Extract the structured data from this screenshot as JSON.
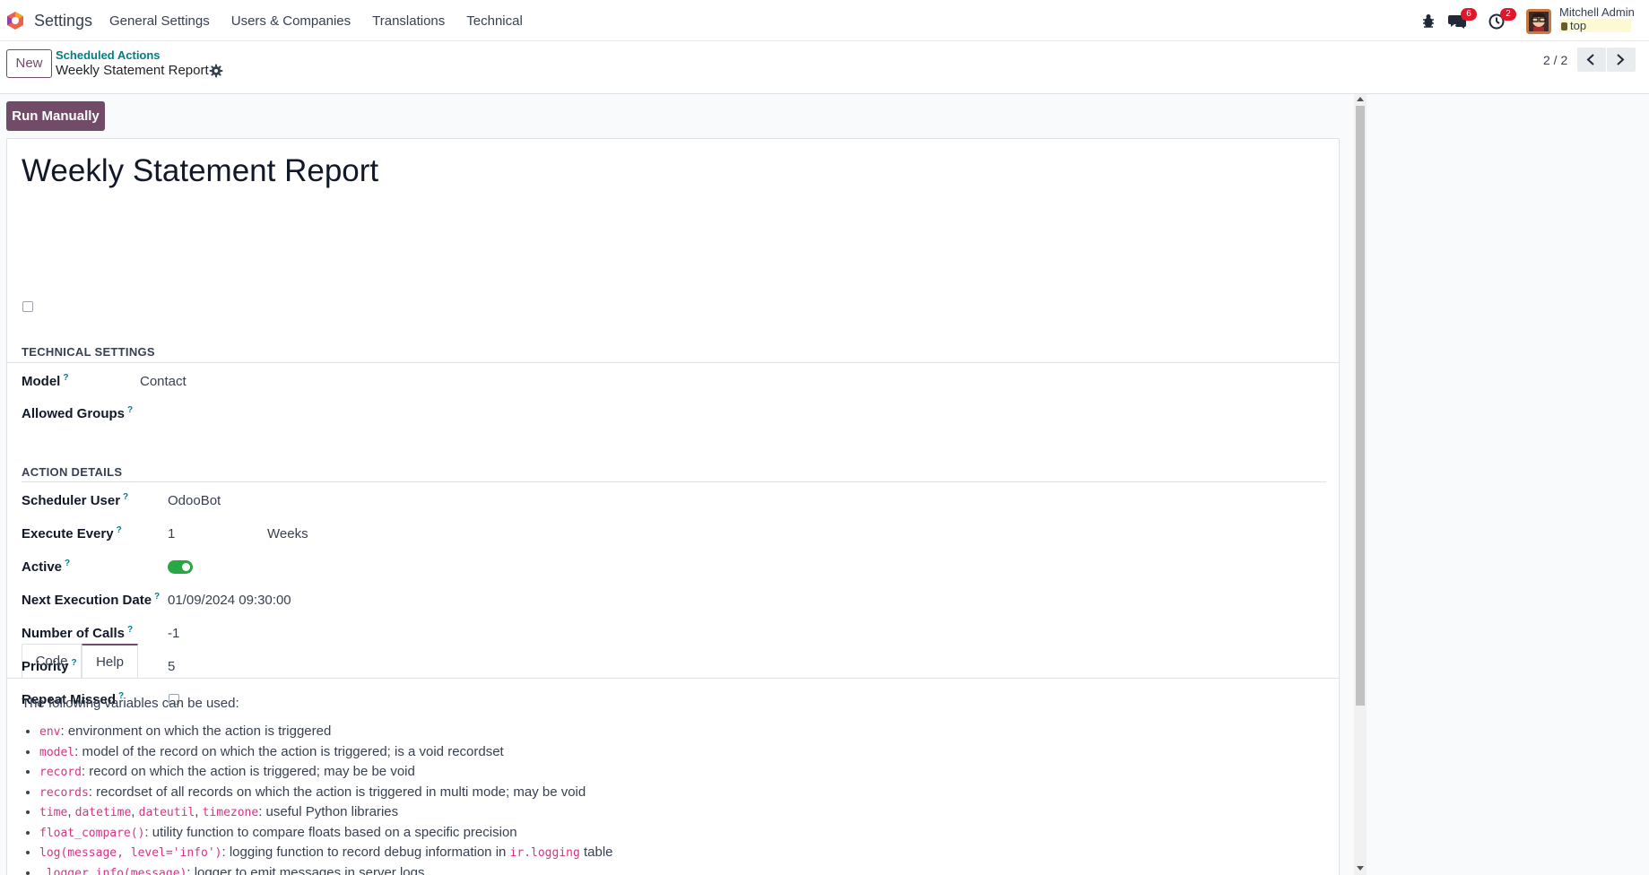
{
  "navbar": {
    "app_name": "Settings",
    "menu": [
      "General Settings",
      "Users & Companies",
      "Translations",
      "Technical"
    ],
    "messages_count": "6",
    "activities_count": "2",
    "user_name": "Mitchell Admin",
    "database": "top"
  },
  "control_panel": {
    "new_label": "New",
    "breadcrumb_parent": "Scheduled Actions",
    "breadcrumb_current": "Weekly Statement Report",
    "pager": "2 / 2"
  },
  "form": {
    "run_button": "Run Manually",
    "title": "Weekly Statement Report",
    "technical_section": "TECHNICAL SETTINGS",
    "model_label": "Model",
    "model_value": "Contact",
    "allowed_groups_label": "Allowed Groups",
    "action_section": "ACTION DETAILS",
    "scheduler_user_label": "Scheduler User",
    "scheduler_user_value": "OdooBot",
    "execute_every_label": "Execute Every",
    "execute_every_value": "1",
    "execute_every_unit": "Weeks",
    "active_label": "Active",
    "active": true,
    "next_execution_label": "Next Execution Date",
    "next_execution_value": "01/09/2024 09:30:00",
    "number_of_calls_label": "Number of Calls",
    "number_of_calls_value": "-1",
    "priority_label": "Priority",
    "priority_value": "5",
    "repeat_missed_label": "Repeat Missed",
    "help_marker": "?"
  },
  "tabs": {
    "code": "Code",
    "help": "Help"
  },
  "help": {
    "intro": "The following variables can be used:",
    "items": [
      {
        "codes": [
          "env"
        ],
        "text": ": environment on which the action is triggered"
      },
      {
        "codes": [
          "model"
        ],
        "text": ": model of the record on which the action is triggered; is a void recordset"
      },
      {
        "codes": [
          "record"
        ],
        "text": ": record on which the action is triggered; may be be void"
      },
      {
        "codes": [
          "records"
        ],
        "text": ": recordset of all records on which the action is triggered in multi mode; may be void"
      },
      {
        "codes": [
          "time",
          "datetime",
          "dateutil",
          "timezone"
        ],
        "text": ": useful Python libraries"
      },
      {
        "codes": [
          "float_compare()"
        ],
        "text": ": utility function to compare floats based on a specific precision"
      },
      {
        "codes": [
          "log(message, level='info')"
        ],
        "text": ": logging function to record debug information in ",
        "code2": "ir.logging",
        "text2": " table"
      },
      {
        "codes": [
          "_logger.info(message)"
        ],
        "text": ": logger to emit messages in server logs"
      }
    ]
  },
  "colors": {
    "brand": "#714b67",
    "link": "#017e84",
    "badge": "#e0162b",
    "toggle_on": "#28a745",
    "code_text": "#d63384"
  },
  "icons": [
    "odoo-logo-icon",
    "bug-icon",
    "chat-icon",
    "clock-icon",
    "gear-icon",
    "chevron-left-icon",
    "chevron-right-icon",
    "database-icon"
  ]
}
